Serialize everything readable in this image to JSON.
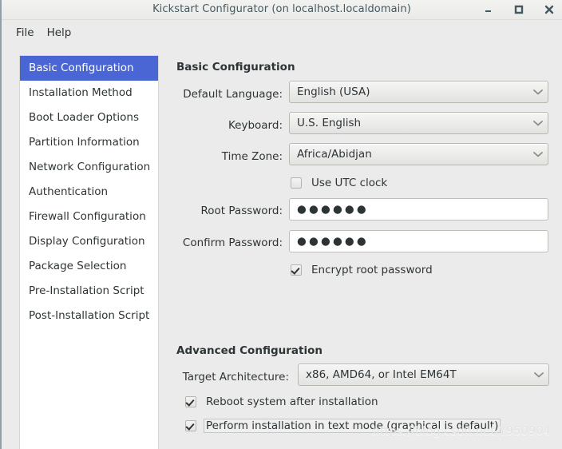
{
  "window": {
    "title": "Kickstart Configurator (on localhost.localdomain)",
    "controls": [
      {
        "name": "minimize",
        "label": "–"
      },
      {
        "name": "maximize",
        "label": "□"
      },
      {
        "name": "close",
        "label": "✕"
      }
    ]
  },
  "menubar": {
    "items": [
      {
        "label": "File"
      },
      {
        "label": "Help"
      }
    ]
  },
  "sidebar": {
    "items": [
      {
        "label": "Basic Configuration",
        "selected": true
      },
      {
        "label": "Installation Method",
        "selected": false
      },
      {
        "label": "Boot Loader Options",
        "selected": false
      },
      {
        "label": "Partition Information",
        "selected": false
      },
      {
        "label": "Network Configuration",
        "selected": false
      },
      {
        "label": "Authentication",
        "selected": false
      },
      {
        "label": "Firewall Configuration",
        "selected": false
      },
      {
        "label": "Display Configuration",
        "selected": false
      },
      {
        "label": "Package Selection",
        "selected": false
      },
      {
        "label": "Pre-Installation Script",
        "selected": false
      },
      {
        "label": "Post-Installation Script",
        "selected": false
      }
    ]
  },
  "basic": {
    "heading": "Basic Configuration",
    "default_language": {
      "label": "Default Language:",
      "value": "English (USA)"
    },
    "keyboard": {
      "label": "Keyboard:",
      "value": "U.S. English"
    },
    "time_zone": {
      "label": "Time Zone:",
      "value": "Africa/Abidjan"
    },
    "use_utc": {
      "label": "Use UTC clock",
      "checked": false
    },
    "root_password": {
      "label": "Root Password:",
      "value": "●●●●●●"
    },
    "confirm_password": {
      "label": "Confirm Password:",
      "value": "●●●●●●"
    },
    "encrypt_root": {
      "label": "Encrypt root password",
      "checked": true
    }
  },
  "advanced": {
    "heading": "Advanced Configuration",
    "target_architecture": {
      "label": "Target Architecture:",
      "value": "x86, AMD64, or Intel EM64T"
    },
    "reboot_after_install": {
      "label": "Reboot system after installation",
      "checked": true
    },
    "text_mode": {
      "label": "Perform installation in text mode (graphical is default)",
      "checked": true,
      "focused": true
    }
  },
  "watermark": {
    "text": "https://blog.csdn.net/Y950904"
  },
  "colors": {
    "selection": "#4a66d4",
    "window_bg": "#ebebeb",
    "text": "#2e3436",
    "title_text": "#46585f"
  }
}
